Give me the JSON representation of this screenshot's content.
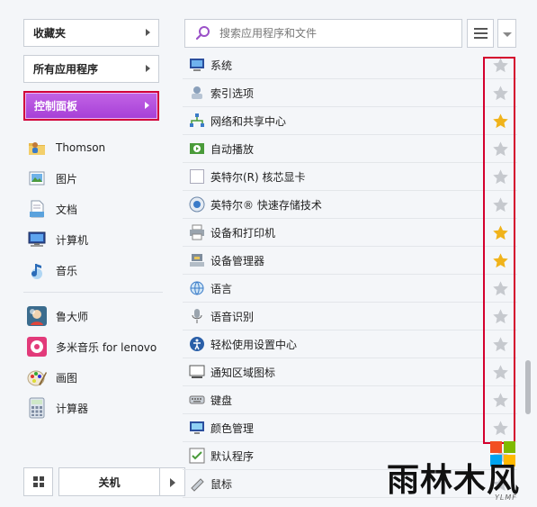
{
  "left_menu": {
    "favorites_label": "收藏夹",
    "all_programs_label": "所有应用程序",
    "control_panel_label": "控制面板"
  },
  "places": [
    {
      "label": "Thomson",
      "icon": "user-folder-icon"
    },
    {
      "label": "图片",
      "icon": "pictures-icon"
    },
    {
      "label": "文档",
      "icon": "documents-icon"
    },
    {
      "label": "计算机",
      "icon": "computer-icon"
    },
    {
      "label": "音乐",
      "icon": "music-icon"
    }
  ],
  "apps": [
    {
      "label": "鲁大师",
      "icon": "ludashi-icon"
    },
    {
      "label": "多米音乐 for lenovo",
      "icon": "duomi-music-icon"
    },
    {
      "label": "画图",
      "icon": "paint-icon"
    },
    {
      "label": "计算器",
      "icon": "calculator-icon"
    }
  ],
  "bottom": {
    "shutdown_label": "关机"
  },
  "search": {
    "placeholder": "搜索应用程序和文件"
  },
  "control_panel_items": [
    {
      "label": "系统",
      "icon": "system-icon",
      "favorited": false
    },
    {
      "label": "索引选项",
      "icon": "indexing-options-icon",
      "favorited": false
    },
    {
      "label": "网络和共享中心",
      "icon": "network-sharing-icon",
      "favorited": true
    },
    {
      "label": "自动播放",
      "icon": "autoplay-icon",
      "favorited": false
    },
    {
      "label": "英特尔(R) 核芯显卡",
      "icon": "intel-graphics-icon",
      "favorited": false
    },
    {
      "label": "英特尔® 快速存储技术",
      "icon": "intel-rapid-storage-icon",
      "favorited": false
    },
    {
      "label": "设备和打印机",
      "icon": "devices-printers-icon",
      "favorited": true
    },
    {
      "label": "设备管理器",
      "icon": "device-manager-icon",
      "favorited": true
    },
    {
      "label": "语言",
      "icon": "language-icon",
      "favorited": false
    },
    {
      "label": "语音识别",
      "icon": "speech-recognition-icon",
      "favorited": false
    },
    {
      "label": "轻松使用设置中心",
      "icon": "ease-of-access-icon",
      "favorited": false
    },
    {
      "label": "通知区域图标",
      "icon": "notification-area-icon",
      "favorited": false
    },
    {
      "label": "键盘",
      "icon": "keyboard-icon",
      "favorited": false
    },
    {
      "label": "颜色管理",
      "icon": "color-management-icon",
      "favorited": false
    },
    {
      "label": "默认程序",
      "icon": "default-programs-icon",
      "favorited": false
    },
    {
      "label": "鼠标",
      "icon": "mouse-icon",
      "favorited": false
    }
  ],
  "watermark": {
    "text": "雨林木风",
    "subtext": "YLMF"
  },
  "colors": {
    "accent_purple": "#b04ee0",
    "highlight_red": "#d4002d",
    "star_gold": "#f0b31b",
    "star_gray": "#c6c9ce"
  }
}
